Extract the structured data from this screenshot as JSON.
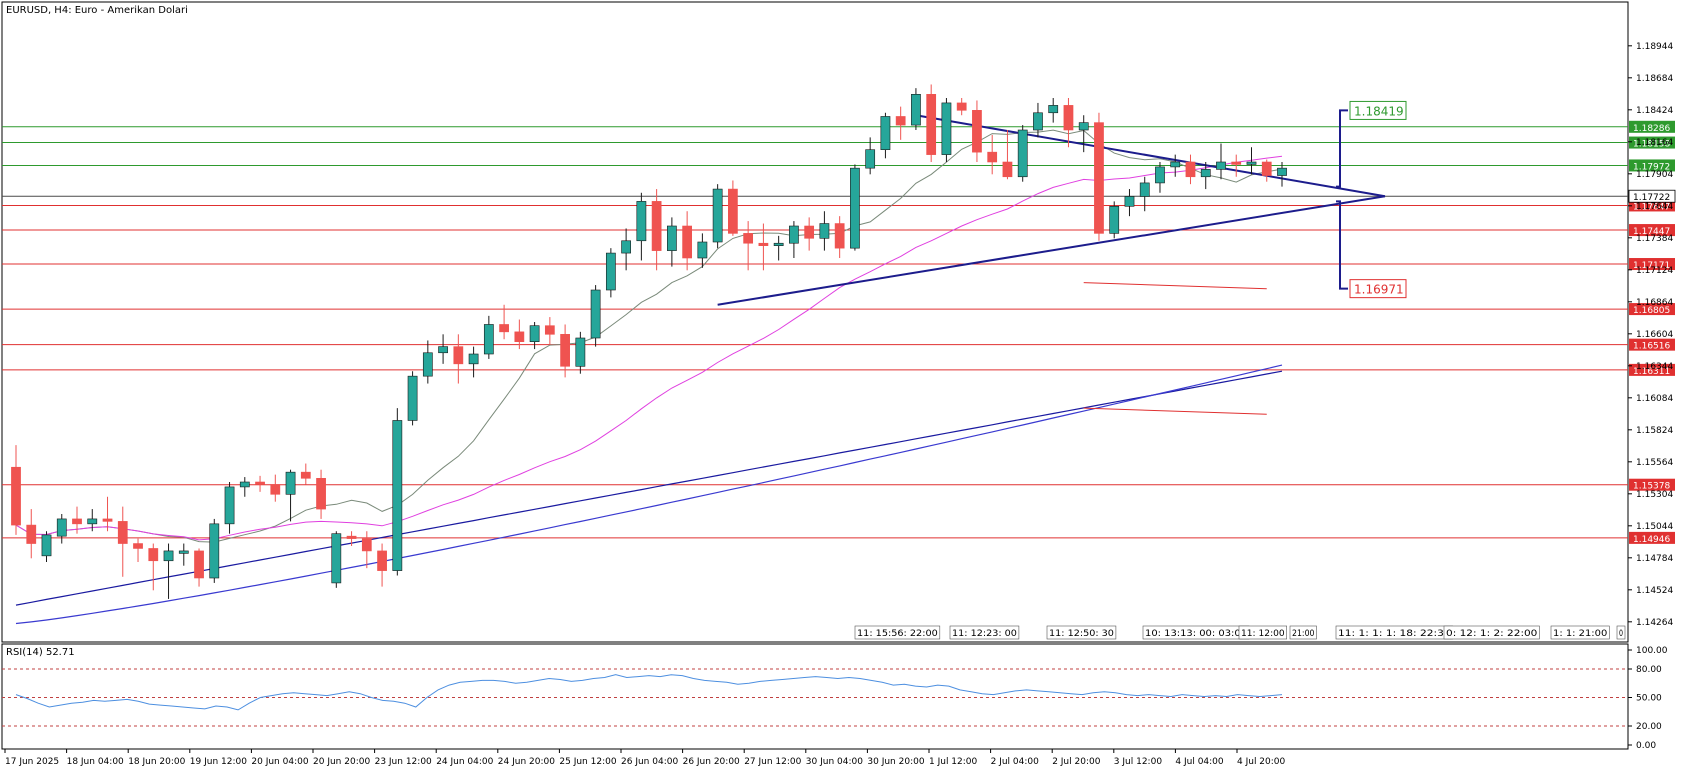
{
  "chart_data": {
    "type": "candlestick",
    "title": "EURUSD, H4:  Euro - Amerikan Dolari",
    "colors": {
      "up": "#26a69a",
      "down": "#ef5350",
      "support_line": "#e03030",
      "resistance_line": "#2e9a2e",
      "triangle": "#1c1c8c",
      "ma_fast": "#7a8a7a",
      "ma_mid": "#e040e0",
      "ma_slow1": "#1a1aa0",
      "ma_slow2": "#3a3ad0",
      "rsi": "#4d8fe0",
      "current_price": "#4a4a4a"
    },
    "y_axis": {
      "range": [
        1.141,
        1.193
      ],
      "ticks": [
        "1.18944",
        "1.18684",
        "1.18424",
        "1.18164",
        "1.17904",
        "1.17644",
        "1.17384",
        "1.17124",
        "1.16864",
        "1.16604",
        "1.16344",
        "1.16084",
        "1.15824",
        "1.15564",
        "1.15304",
        "1.15044",
        "1.14784",
        "1.14524",
        "1.14264"
      ]
    },
    "x_axis": {
      "labels": [
        "17 Jun 2025",
        "18 Jun 04:00",
        "18 Jun 20:00",
        "19 Jun 12:00",
        "20 Jun 04:00",
        "20 Jun 20:00",
        "23 Jun 12:00",
        "24 Jun 04:00",
        "24 Jun 20:00",
        "25 Jun 12:00",
        "26 Jun 04:00",
        "26 Jun 20:00",
        "27 Jun 12:00",
        "30 Jun 04:00",
        "30 Jun 20:00",
        "1 Jul 12:00",
        "2 Jul 04:00",
        "2 Jul 20:00",
        "3 Jul 12:00",
        "4 Jul 04:00",
        "4 Jul 20:00"
      ]
    },
    "candles": [
      [
        1.1552,
        1.157,
        1.1497,
        1.1505
      ],
      [
        1.1505,
        1.1518,
        1.1478,
        1.149
      ],
      [
        1.148,
        1.15,
        1.1475,
        1.1497
      ],
      [
        1.1496,
        1.1514,
        1.149,
        1.151
      ],
      [
        1.151,
        1.152,
        1.1498,
        1.1506
      ],
      [
        1.1506,
        1.1518,
        1.15,
        1.151
      ],
      [
        1.151,
        1.1528,
        1.15,
        1.1508
      ],
      [
        1.1508,
        1.152,
        1.1463,
        1.149
      ],
      [
        1.149,
        1.1494,
        1.1475,
        1.1486
      ],
      [
        1.1486,
        1.149,
        1.1452,
        1.1476
      ],
      [
        1.1476,
        1.149,
        1.1445,
        1.1484
      ],
      [
        1.1482,
        1.149,
        1.1472,
        1.1484
      ],
      [
        1.1484,
        1.1486,
        1.1455,
        1.1462
      ],
      [
        1.1462,
        1.151,
        1.1458,
        1.1506
      ],
      [
        1.1506,
        1.154,
        1.1498,
        1.1536
      ],
      [
        1.1536,
        1.1544,
        1.1528,
        1.154
      ],
      [
        1.154,
        1.1545,
        1.1532,
        1.1538
      ],
      [
        1.1538,
        1.1546,
        1.1524,
        1.153
      ],
      [
        1.153,
        1.155,
        1.1508,
        1.1548
      ],
      [
        1.1548,
        1.1555,
        1.1538,
        1.1543
      ],
      [
        1.1543,
        1.155,
        1.151,
        1.1518
      ],
      [
        1.1458,
        1.15,
        1.1454,
        1.1498
      ],
      [
        1.1496,
        1.15,
        1.1488,
        1.1494
      ],
      [
        1.1494,
        1.15,
        1.147,
        1.1484
      ],
      [
        1.1484,
        1.149,
        1.1455,
        1.1468
      ],
      [
        1.1468,
        1.16,
        1.1464,
        1.159
      ],
      [
        1.159,
        1.163,
        1.1586,
        1.1626
      ],
      [
        1.1626,
        1.1655,
        1.162,
        1.1645
      ],
      [
        1.1645,
        1.166,
        1.1636,
        1.165
      ],
      [
        1.165,
        1.166,
        1.162,
        1.1636
      ],
      [
        1.1636,
        1.165,
        1.1625,
        1.1644
      ],
      [
        1.1644,
        1.1675,
        1.164,
        1.1668
      ],
      [
        1.1668,
        1.1684,
        1.1656,
        1.1662
      ],
      [
        1.1662,
        1.1672,
        1.1648,
        1.1654
      ],
      [
        1.1654,
        1.167,
        1.1648,
        1.1667
      ],
      [
        1.1667,
        1.1674,
        1.1652,
        1.166
      ],
      [
        1.166,
        1.1668,
        1.1625,
        1.1634
      ],
      [
        1.1634,
        1.1662,
        1.1628,
        1.1657
      ],
      [
        1.1657,
        1.17,
        1.165,
        1.1696
      ],
      [
        1.1696,
        1.173,
        1.169,
        1.1726
      ],
      [
        1.1726,
        1.1746,
        1.1712,
        1.1736
      ],
      [
        1.1736,
        1.1775,
        1.172,
        1.1768
      ],
      [
        1.1768,
        1.1778,
        1.1712,
        1.1728
      ],
      [
        1.1728,
        1.1755,
        1.1715,
        1.1748
      ],
      [
        1.1748,
        1.176,
        1.1712,
        1.1722
      ],
      [
        1.1722,
        1.1742,
        1.1714,
        1.1735
      ],
      [
        1.1735,
        1.1782,
        1.173,
        1.1778
      ],
      [
        1.1778,
        1.1785,
        1.174,
        1.1742
      ],
      [
        1.1742,
        1.1752,
        1.1712,
        1.1734
      ],
      [
        1.1734,
        1.175,
        1.1712,
        1.1732
      ],
      [
        1.1732,
        1.174,
        1.172,
        1.1734
      ],
      [
        1.1734,
        1.1752,
        1.1722,
        1.1748
      ],
      [
        1.1748,
        1.1755,
        1.1728,
        1.1738
      ],
      [
        1.1738,
        1.176,
        1.1728,
        1.175
      ],
      [
        1.175,
        1.1756,
        1.1722,
        1.173
      ],
      [
        1.173,
        1.1798,
        1.1728,
        1.1795
      ],
      [
        1.1795,
        1.182,
        1.179,
        1.181
      ],
      [
        1.181,
        1.184,
        1.1803,
        1.1837
      ],
      [
        1.1837,
        1.1845,
        1.1818,
        1.183
      ],
      [
        1.183,
        1.186,
        1.1826,
        1.1855
      ],
      [
        1.1855,
        1.1863,
        1.18,
        1.1806
      ],
      [
        1.1806,
        1.1852,
        1.18,
        1.1848
      ],
      [
        1.1848,
        1.1852,
        1.1838,
        1.1842
      ],
      [
        1.1842,
        1.185,
        1.18,
        1.1808
      ],
      [
        1.1808,
        1.1822,
        1.179,
        1.18
      ],
      [
        1.18,
        1.1826,
        1.1786,
        1.1788
      ],
      [
        1.1788,
        1.183,
        1.1784,
        1.1826
      ],
      [
        1.1826,
        1.1848,
        1.182,
        1.184
      ],
      [
        1.184,
        1.1852,
        1.1832,
        1.1846
      ],
      [
        1.1846,
        1.1852,
        1.1812,
        1.1826
      ],
      [
        1.1826,
        1.1838,
        1.1808,
        1.1832
      ],
      [
        1.1832,
        1.184,
        1.1736,
        1.1742
      ],
      [
        1.1742,
        1.1768,
        1.1738,
        1.1764
      ],
      [
        1.1764,
        1.1778,
        1.1756,
        1.1772
      ],
      [
        1.1772,
        1.1788,
        1.176,
        1.1783
      ],
      [
        1.1783,
        1.18,
        1.1775,
        1.1796
      ],
      [
        1.1796,
        1.1806,
        1.1788,
        1.18
      ],
      [
        1.18,
        1.1806,
        1.1782,
        1.1788
      ],
      [
        1.1788,
        1.18,
        1.1778,
        1.1794
      ],
      [
        1.1794,
        1.1815,
        1.1786,
        1.18
      ],
      [
        1.18,
        1.1806,
        1.1788,
        1.1798
      ],
      [
        1.1798,
        1.1812,
        1.179,
        1.18
      ],
      [
        1.18,
        1.1802,
        1.1784,
        1.1789
      ],
      [
        1.1789,
        1.18,
        1.178,
        1.1795
      ]
    ],
    "horizontal_levels": [
      {
        "price": 1.18286,
        "label": "1.18286",
        "color": "#2e9a2e"
      },
      {
        "price": 1.18158,
        "label": "1.18158",
        "color": "#2e9a2e"
      },
      {
        "price": 1.17972,
        "label": "1.17972",
        "color": "#2e9a2e"
      },
      {
        "price": 1.17647,
        "label": "1.17647",
        "color": "#e03030"
      },
      {
        "price": 1.17447,
        "label": "1.17447",
        "color": "#e03030"
      },
      {
        "price": 1.17171,
        "label": "1.17171",
        "color": "#e03030"
      },
      {
        "price": 1.16805,
        "label": "1.16805",
        "color": "#e03030"
      },
      {
        "price": 1.16516,
        "label": "1.16516",
        "color": "#e03030"
      },
      {
        "price": 1.16311,
        "label": "1.16311",
        "color": "#e03030"
      },
      {
        "price": 1.15378,
        "label": "1.15378",
        "color": "#e03030"
      },
      {
        "price": 1.14946,
        "label": "1.14946",
        "color": "#e03030"
      }
    ],
    "current_price": {
      "price": 1.17722,
      "label": "1.17722"
    },
    "targets": {
      "up": "1.18419",
      "down": "1.16971"
    },
    "rsi": {
      "label": "RSI(14) 52.71",
      "range": [
        0,
        100
      ],
      "ticks": [
        "100.00",
        "80.00",
        "50.00",
        "20.00",
        "0.00"
      ],
      "levels": [
        80,
        50,
        20
      ],
      "values": [
        53,
        49,
        44,
        40,
        42,
        44,
        45,
        47,
        46,
        47,
        48,
        46,
        43,
        42,
        41,
        40,
        39,
        38,
        41,
        40,
        37,
        44,
        50,
        52,
        54,
        55,
        54,
        53,
        52,
        54,
        56,
        54,
        50,
        47,
        46,
        44,
        40,
        50,
        58,
        63,
        66,
        67,
        68,
        68,
        67,
        65,
        66,
        68,
        70,
        69,
        67,
        68,
        70,
        71,
        74,
        71,
        72,
        73,
        72,
        74,
        73,
        70,
        68,
        67,
        66,
        64,
        65,
        67,
        68,
        69,
        70,
        71,
        72,
        71,
        70,
        71,
        70,
        68,
        66,
        63,
        64,
        62,
        61,
        63,
        62,
        58,
        56,
        54,
        53,
        55,
        57,
        58,
        57,
        56,
        55,
        54,
        53,
        55,
        56,
        55,
        53,
        52,
        53,
        52,
        51,
        53,
        52,
        51,
        52,
        51,
        53,
        52,
        51,
        52,
        53
      ]
    },
    "time_labels": [
      "11: 15:56: 22:00",
      "11: 12:23: 00",
      "11: 12:50: 30",
      "10: 13:13: 00: 03:00",
      "11: 12:00",
      "21:00",
      "11: 1: 1: 1: 18: 22:30",
      "0: 12: 1: 2: 22:00",
      "1: 1: 21:00",
      "0"
    ]
  }
}
